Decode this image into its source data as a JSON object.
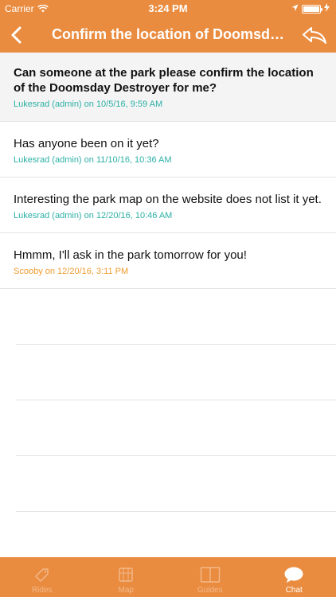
{
  "status_bar": {
    "carrier": "Carrier",
    "time": "3:24 PM"
  },
  "header": {
    "title": "Confirm the location of Doomsday Destroyer"
  },
  "messages": [
    {
      "text": "Can someone at the park please confirm the location of the Doomsday Destroyer for me?",
      "meta": "Lukesrad (admin) on 10/5/16, 9:59 AM"
    },
    {
      "text": "Has anyone been on it yet?",
      "meta": "Lukesrad (admin) on 11/10/16, 10:36 AM"
    },
    {
      "text": "Interesting the park map on the website does not list it yet.",
      "meta": "Lukesrad (admin) on 12/20/16, 10:46 AM"
    },
    {
      "text": "Hmmm, I'll ask in the park tomorrow for you!",
      "meta": "Scooby on 12/20/16, 3:11 PM"
    }
  ],
  "tabs": [
    {
      "label": "Rides",
      "icon": "tag-icon"
    },
    {
      "label": "Map",
      "icon": "map-icon"
    },
    {
      "label": "Guides",
      "icon": "book-icon"
    },
    {
      "label": "Chat",
      "icon": "chat-bubble-icon",
      "active": true
    }
  ],
  "colors": {
    "accent": "#ea8c3f",
    "admin_meta": "#2bb0a6",
    "user_meta": "#ef9b2e"
  }
}
